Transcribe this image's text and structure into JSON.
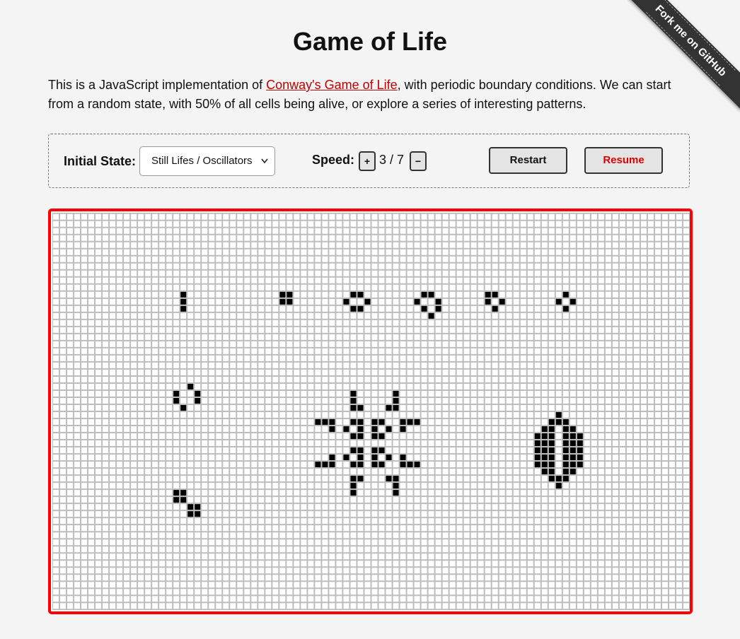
{
  "title": "Game of Life",
  "intro": {
    "before": "This is a JavaScript implementation of ",
    "link": "Conway's Game of Life",
    "after": ", with periodic boundary conditions. We can start from a random state, with 50% of all cells being alive, or explore a series of interesting patterns."
  },
  "ribbon": "Fork me on GitHub",
  "controls": {
    "initial_state_label": "Initial State:",
    "initial_state_value": "Still Lifes / Oscillators",
    "speed_label": "Speed:",
    "speed_value": "3 / 7",
    "plus_label": "+",
    "minus_label": "−",
    "restart_label": "Restart",
    "resume_label": "Resume"
  },
  "board": {
    "cols": 90,
    "rows": 56,
    "alive_color": "#000000",
    "grid_color": "#bdbdbd",
    "border_color": "#ff0000",
    "alive_cells": [
      [
        18,
        11
      ],
      [
        18,
        12
      ],
      [
        18,
        13
      ],
      [
        32,
        11
      ],
      [
        33,
        11
      ],
      [
        32,
        12
      ],
      [
        33,
        12
      ],
      [
        42,
        11
      ],
      [
        43,
        11
      ],
      [
        41,
        12
      ],
      [
        44,
        12
      ],
      [
        42,
        13
      ],
      [
        43,
        13
      ],
      [
        52,
        11
      ],
      [
        53,
        11
      ],
      [
        51,
        12
      ],
      [
        54,
        12
      ],
      [
        52,
        13
      ],
      [
        54,
        13
      ],
      [
        53,
        14
      ],
      [
        61,
        11
      ],
      [
        62,
        11
      ],
      [
        61,
        12
      ],
      [
        63,
        12
      ],
      [
        62,
        13
      ],
      [
        72,
        11
      ],
      [
        71,
        12
      ],
      [
        73,
        12
      ],
      [
        72,
        13
      ],
      [
        19,
        24
      ],
      [
        17,
        25
      ],
      [
        20,
        25
      ],
      [
        17,
        26
      ],
      [
        20,
        26
      ],
      [
        18,
        27
      ],
      [
        17,
        39
      ],
      [
        18,
        39
      ],
      [
        17,
        40
      ],
      [
        18,
        40
      ],
      [
        19,
        41
      ],
      [
        20,
        41
      ],
      [
        19,
        42
      ],
      [
        20,
        42
      ],
      [
        42,
        25
      ],
      [
        48,
        25
      ],
      [
        42,
        26
      ],
      [
        48,
        26
      ],
      [
        42,
        27
      ],
      [
        43,
        27
      ],
      [
        47,
        27
      ],
      [
        48,
        27
      ],
      [
        37,
        29
      ],
      [
        38,
        29
      ],
      [
        39,
        29
      ],
      [
        42,
        29
      ],
      [
        43,
        29
      ],
      [
        45,
        29
      ],
      [
        46,
        29
      ],
      [
        49,
        29
      ],
      [
        50,
        29
      ],
      [
        51,
        29
      ],
      [
        39,
        30
      ],
      [
        41,
        30
      ],
      [
        43,
        30
      ],
      [
        45,
        30
      ],
      [
        47,
        30
      ],
      [
        49,
        30
      ],
      [
        42,
        31
      ],
      [
        43,
        31
      ],
      [
        45,
        31
      ],
      [
        46,
        31
      ],
      [
        42,
        33
      ],
      [
        43,
        33
      ],
      [
        45,
        33
      ],
      [
        46,
        33
      ],
      [
        39,
        34
      ],
      [
        41,
        34
      ],
      [
        43,
        34
      ],
      [
        45,
        34
      ],
      [
        47,
        34
      ],
      [
        49,
        34
      ],
      [
        37,
        35
      ],
      [
        38,
        35
      ],
      [
        39,
        35
      ],
      [
        42,
        35
      ],
      [
        43,
        35
      ],
      [
        45,
        35
      ],
      [
        46,
        35
      ],
      [
        49,
        35
      ],
      [
        50,
        35
      ],
      [
        51,
        35
      ],
      [
        42,
        37
      ],
      [
        43,
        37
      ],
      [
        47,
        37
      ],
      [
        48,
        37
      ],
      [
        42,
        38
      ],
      [
        48,
        38
      ],
      [
        42,
        39
      ],
      [
        48,
        39
      ],
      [
        71,
        28
      ],
      [
        70,
        29
      ],
      [
        71,
        29
      ],
      [
        72,
        29
      ],
      [
        69,
        30
      ],
      [
        70,
        30
      ],
      [
        72,
        30
      ],
      [
        73,
        30
      ],
      [
        68,
        31
      ],
      [
        69,
        31
      ],
      [
        70,
        31
      ],
      [
        72,
        31
      ],
      [
        73,
        31
      ],
      [
        74,
        31
      ],
      [
        68,
        32
      ],
      [
        69,
        32
      ],
      [
        70,
        32
      ],
      [
        72,
        32
      ],
      [
        73,
        32
      ],
      [
        74,
        32
      ],
      [
        68,
        33
      ],
      [
        69,
        33
      ],
      [
        70,
        33
      ],
      [
        72,
        33
      ],
      [
        73,
        33
      ],
      [
        74,
        33
      ],
      [
        68,
        34
      ],
      [
        69,
        34
      ],
      [
        70,
        34
      ],
      [
        72,
        34
      ],
      [
        73,
        34
      ],
      [
        74,
        34
      ],
      [
        68,
        35
      ],
      [
        69,
        35
      ],
      [
        70,
        35
      ],
      [
        72,
        35
      ],
      [
        73,
        35
      ],
      [
        74,
        35
      ],
      [
        69,
        36
      ],
      [
        70,
        36
      ],
      [
        72,
        36
      ],
      [
        73,
        36
      ],
      [
        70,
        37
      ],
      [
        71,
        37
      ],
      [
        72,
        37
      ],
      [
        71,
        38
      ]
    ]
  }
}
